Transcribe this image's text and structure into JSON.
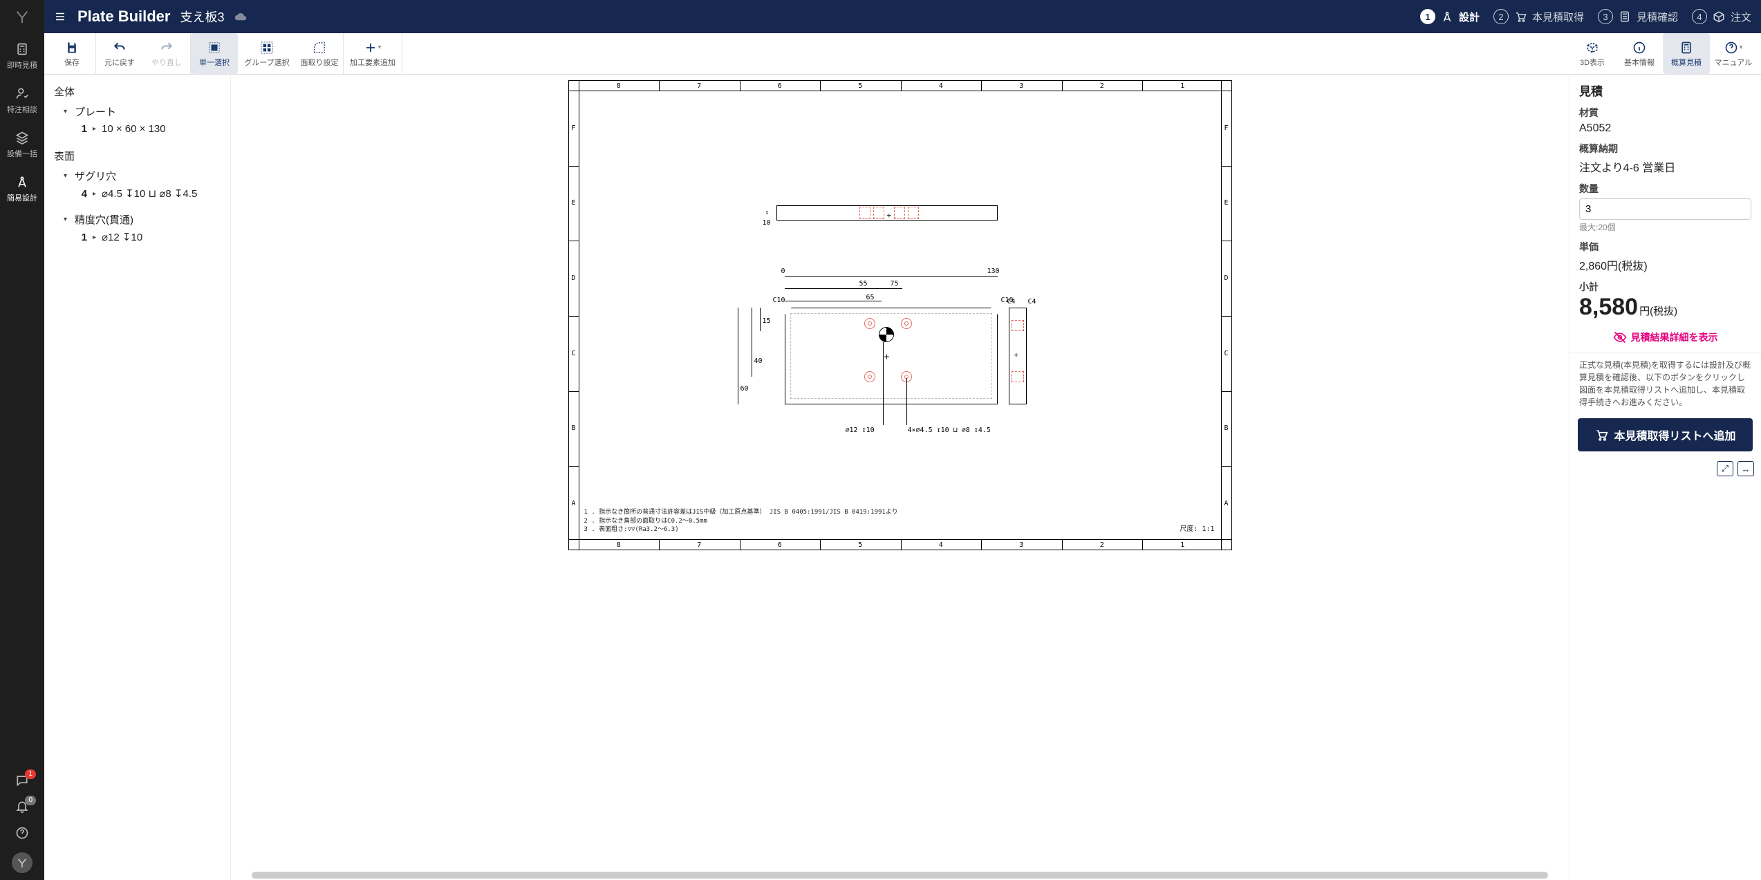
{
  "titlebar": {
    "app_title": "Plate Builder",
    "doc_name": "支え板3"
  },
  "steps": [
    {
      "num": "1",
      "label": "設計",
      "active": true
    },
    {
      "num": "2",
      "label": "本見積取得"
    },
    {
      "num": "3",
      "label": "見積確認"
    },
    {
      "num": "4",
      "label": "注文"
    }
  ],
  "rail": {
    "items": [
      {
        "label": "即時見積"
      },
      {
        "label": "特注相談"
      },
      {
        "label": "設備一括"
      },
      {
        "label": "簡易設計",
        "active": true
      }
    ],
    "chat_badge": "1",
    "bell_badge": "0"
  },
  "toolbar": {
    "save": "保存",
    "undo": "元に戻す",
    "redo": "やり直し",
    "single_select": "単一選択",
    "group_select": "グループ選択",
    "chamfer": "面取り設定",
    "add_feature": "加工要素追加",
    "view3d": "3D表示",
    "basic_info": "基本情報",
    "estimate": "概算見積",
    "manual": "マニュアル"
  },
  "tree": {
    "all": "全体",
    "plate": "プレート",
    "plate_leaf_num": "1",
    "plate_leaf_dim": "10 × 60 × 130",
    "surface": "表面",
    "counterbore": "ザグリ穴",
    "cb_num": "4",
    "cb_spec": "⌀4.5 ↧10 ⊔ ⌀8 ↧4.5",
    "precision_hole": "精度穴(貫通)",
    "ph_num": "1",
    "ph_spec": "⌀12 ↧10"
  },
  "drawing": {
    "zones_h": [
      "8",
      "7",
      "6",
      "5",
      "4",
      "3",
      "2",
      "1"
    ],
    "zones_v": [
      "F",
      "E",
      "D",
      "C",
      "B",
      "A"
    ],
    "dims": {
      "d0": "0",
      "d55": "55",
      "d75": "75",
      "d130": "130",
      "d65": "65",
      "c10l": "C10",
      "c10r": "C10",
      "c4a": "C4",
      "c4b": "C4",
      "d15": "15",
      "d40": "40",
      "d60": "60",
      "phi12": "⌀12 ↧10",
      "cb_call": "4×⌀4.5 ↧10 ⊔ ⌀8 ↧4.5"
    },
    "top_arrow": "10",
    "notes": [
      "1 . 指示なき箇所の普通寸法許容差はJIS中級（加工原点基準） JIS B 0405:1991/JIS B 0419:1991より",
      "2 . 指示なき角部の面取りはC0.2～0.5mm",
      "3 . 表面粗さ:▽▽(Ra3.2～6.3)"
    ],
    "scale": "尺度: 1:1"
  },
  "estimate": {
    "title": "見積",
    "material_label": "材質",
    "material": "A5052",
    "leadtime_label": "概算納期",
    "leadtime": "注文より4-6 営業日",
    "qty_label": "数量",
    "qty_value": "3",
    "qty_hint": "最大:20個",
    "unit_price_label": "単価",
    "unit_price": "2,860円(税抜)",
    "subtotal_label": "小計",
    "subtotal_value": "8,580",
    "subtotal_unit": "円(税抜)",
    "detail_link": "見積結果詳細を表示",
    "note": "正式な見積(本見積)を取得するには設計及び概算見積を確認後、以下のボタンをクリックし図面を本見積取得リストへ追加し、本見積取得手続きへお進みください。",
    "cta": "本見積取得リストへ追加"
  }
}
